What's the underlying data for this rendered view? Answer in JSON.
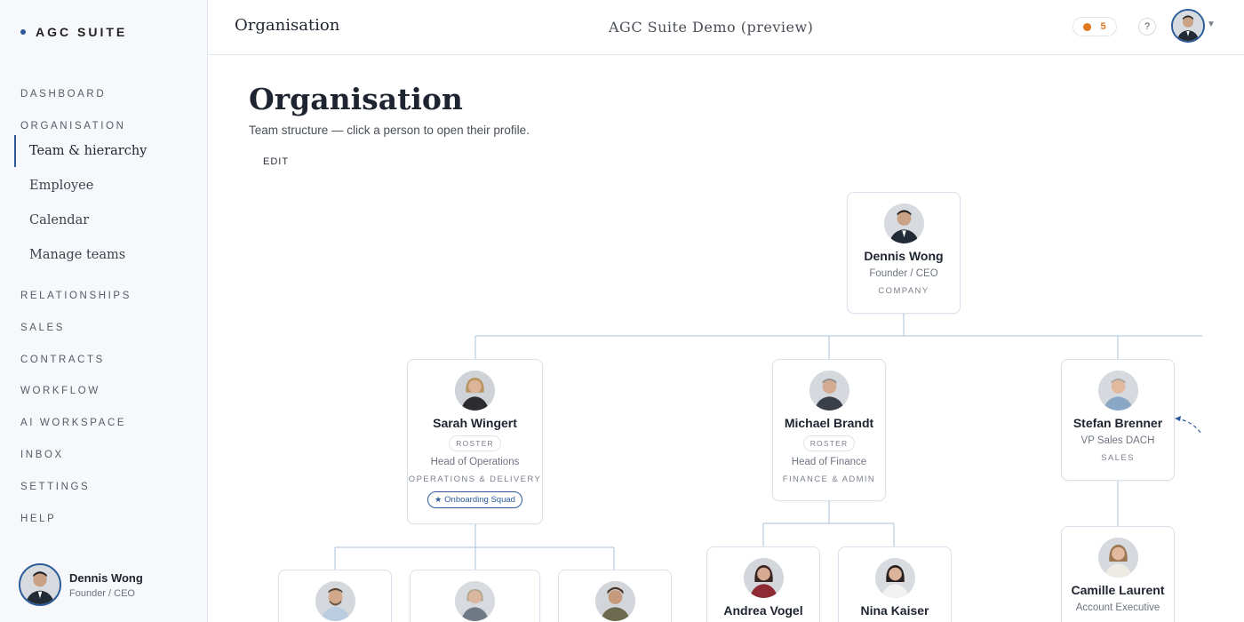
{
  "brand": {
    "name": "AGC SUITE"
  },
  "sidebar": {
    "sections": {
      "dashboard": "DASHBOARD",
      "organisation": "ORGANISATION",
      "relationships": "RELATIONSHIPS",
      "sales": "SALES",
      "contracts": "CONTRACTS",
      "workflow": "WORKFLOW",
      "ai_workspace": "AI WORKSPACE",
      "inbox": "INBOX",
      "settings": "SETTINGS",
      "help": "HELP"
    },
    "items": [
      {
        "label": "Team & hierarchy",
        "active": true
      },
      {
        "label": "Employee"
      },
      {
        "label": "Calendar"
      },
      {
        "label": "Manage teams"
      }
    ],
    "user": {
      "name": "Dennis Wong",
      "role": "Founder / CEO"
    }
  },
  "header": {
    "title": "Organisation",
    "center": "AGC Suite Demo (preview)",
    "notifications": "5",
    "help": "?"
  },
  "main": {
    "title": "Organisation",
    "subtitle": "Team structure — click a person to open their profile.",
    "edit_label": "EDIT"
  },
  "org": {
    "ceo": {
      "name": "Dennis Wong",
      "role": "Founder / CEO",
      "dept": "COMPANY"
    },
    "sarah": {
      "name": "Sarah Wingert",
      "badge": "ROSTER",
      "role": "Head of Operations",
      "dept": "OPERATIONS & DELIVERY",
      "squad": "Onboarding Squad"
    },
    "michael": {
      "name": "Michael Brandt",
      "badge": "ROSTER",
      "role": "Head of Finance",
      "dept": "FINANCE & ADMIN"
    },
    "stefan": {
      "name": "Stefan Brenner",
      "role": "VP Sales DACH",
      "dept": "SALES"
    },
    "andrea": {
      "name": "Andrea Vogel"
    },
    "nina": {
      "name": "Nina Kaiser"
    },
    "camille": {
      "name": "Camille Laurent",
      "role": "Account Executive"
    }
  },
  "colors": {
    "accent": "#2a5b98",
    "notification": "#e0781f",
    "connector": "#aac0d8"
  }
}
